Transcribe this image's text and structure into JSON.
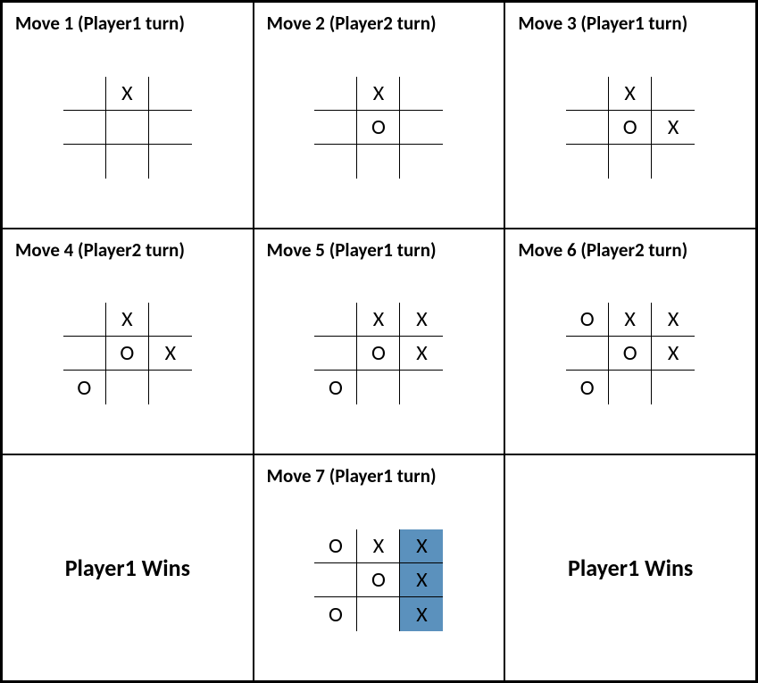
{
  "panels": [
    {
      "kind": "move",
      "title": "Move 1 (Player1 turn)",
      "board": [
        [
          "",
          "X",
          ""
        ],
        [
          "",
          "",
          ""
        ],
        [
          "",
          "",
          ""
        ]
      ],
      "highlight": []
    },
    {
      "kind": "move",
      "title": "Move 2 (Player2 turn)",
      "board": [
        [
          "",
          "X",
          ""
        ],
        [
          "",
          "O",
          ""
        ],
        [
          "",
          "",
          ""
        ]
      ],
      "highlight": []
    },
    {
      "kind": "move",
      "title": "Move 3 (Player1 turn)",
      "board": [
        [
          "",
          "X",
          ""
        ],
        [
          "",
          "O",
          "X"
        ],
        [
          "",
          "",
          ""
        ]
      ],
      "highlight": []
    },
    {
      "kind": "move",
      "title": "Move 4 (Player2 turn)",
      "board": [
        [
          "",
          "X",
          ""
        ],
        [
          "",
          "O",
          "X"
        ],
        [
          "O",
          "",
          ""
        ]
      ],
      "highlight": []
    },
    {
      "kind": "move",
      "title": "Move 5 (Player1 turn)",
      "board": [
        [
          "",
          "X",
          "X"
        ],
        [
          "",
          "O",
          "X"
        ],
        [
          "O",
          "",
          ""
        ]
      ],
      "highlight": []
    },
    {
      "kind": "move",
      "title": "Move 6 (Player2 turn)",
      "board": [
        [
          "O",
          "X",
          "X"
        ],
        [
          "",
          "O",
          "X"
        ],
        [
          "O",
          "",
          ""
        ]
      ],
      "highlight": []
    },
    {
      "kind": "win",
      "message": "Player1 Wins"
    },
    {
      "kind": "move",
      "title": "Move 7 (Player1 turn)",
      "board": [
        [
          "O",
          "X",
          "X"
        ],
        [
          "",
          "O",
          "X"
        ],
        [
          "O",
          "",
          "X"
        ]
      ],
      "highlight": [
        [
          0,
          2
        ],
        [
          1,
          2
        ],
        [
          2,
          2
        ]
      ]
    },
    {
      "kind": "win",
      "message": "Player1 Wins"
    }
  ]
}
